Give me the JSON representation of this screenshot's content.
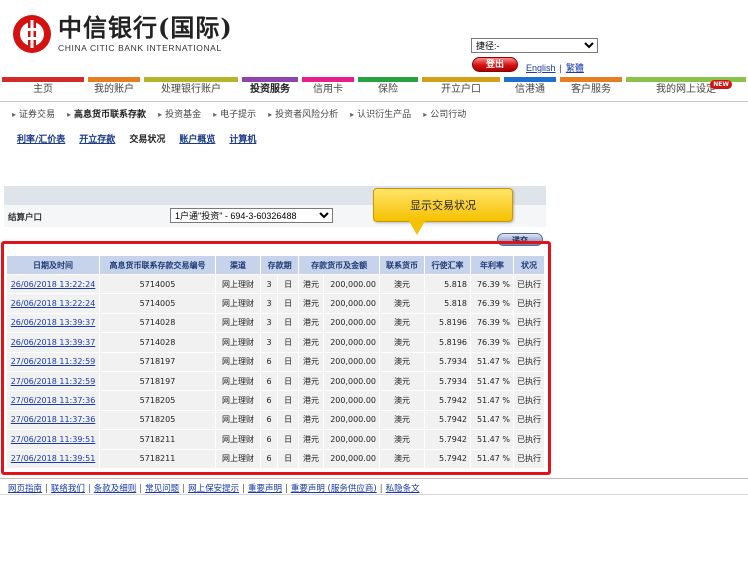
{
  "brand": {
    "name_cn": "中信银行(国际)",
    "name_en": "CHINA CITIC BANK INTERNATIONAL"
  },
  "header": {
    "quick_select_value": "捷径:-",
    "logout_label": "登出",
    "lang_english": "English",
    "lang_sep": "|",
    "lang_traditional": "繁體"
  },
  "nav": [
    {
      "label": "主页",
      "color": "#d12a2a"
    },
    {
      "label": "我的账户",
      "color": "#e67e22"
    },
    {
      "label": "处理银行账户",
      "color": "#b5b52b"
    },
    {
      "label": "投资服务",
      "color": "#8e44ad"
    },
    {
      "label": "信用卡",
      "color": "#e91e8c"
    },
    {
      "label": "保险",
      "color": "#27a243"
    },
    {
      "label": "开立户口",
      "color": "#d4a017"
    },
    {
      "label": "信港通",
      "color": "#1f6fd1"
    },
    {
      "label": "客户服务",
      "color": "#e67e22"
    },
    {
      "label": "我的网上设定",
      "color": "#8bc34a",
      "badge": "NEW"
    }
  ],
  "subnav": [
    {
      "label": "证券交易"
    },
    {
      "label": "高息货币联系存款"
    },
    {
      "label": "投资基金"
    },
    {
      "label": "电子提示"
    },
    {
      "label": "投资者风险分析"
    },
    {
      "label": "认识衍生产品"
    },
    {
      "label": "公司行动"
    }
  ],
  "tabs": [
    {
      "label": "利率/汇价表"
    },
    {
      "label": "开立存款"
    },
    {
      "label": "交易状况"
    },
    {
      "label": "账户概览"
    },
    {
      "label": "计算机"
    }
  ],
  "settlement": {
    "label": "结算户口",
    "account_value": "1户通\"投资\" - 694-3-60326488"
  },
  "callout": {
    "text": "显示交易状况"
  },
  "submit_label": "递交",
  "table": {
    "headers": [
      "日期及时间",
      "高息货币联系存款交易编号",
      "渠道",
      "存款期",
      "存款货币及金额",
      "联系货币",
      "行使汇率",
      "年利率",
      "状况"
    ],
    "rows": [
      {
        "datetime": "26/06/2018 13:22:24",
        "ref": "5714005",
        "channel": "网上理财",
        "term_num": "3",
        "term_unit": "日",
        "currency": "港元",
        "amount": "200,000.00",
        "linked": "澳元",
        "rate": "5.818",
        "interest": "76.39 %",
        "status": "已执行"
      },
      {
        "datetime": "26/06/2018 13:22:24",
        "ref": "5714005",
        "channel": "网上理财",
        "term_num": "3",
        "term_unit": "日",
        "currency": "港元",
        "amount": "200,000.00",
        "linked": "澳元",
        "rate": "5.818",
        "interest": "76.39 %",
        "status": "已执行"
      },
      {
        "datetime": "26/06/2018 13:39:37",
        "ref": "5714028",
        "channel": "网上理财",
        "term_num": "3",
        "term_unit": "日",
        "currency": "港元",
        "amount": "200,000.00",
        "linked": "澳元",
        "rate": "5.8196",
        "interest": "76.39 %",
        "status": "已执行"
      },
      {
        "datetime": "26/06/2018 13:39:37",
        "ref": "5714028",
        "channel": "网上理财",
        "term_num": "3",
        "term_unit": "日",
        "currency": "港元",
        "amount": "200,000.00",
        "linked": "澳元",
        "rate": "5.8196",
        "interest": "76.39 %",
        "status": "已执行"
      },
      {
        "datetime": "27/06/2018 11:32:59",
        "ref": "5718197",
        "channel": "网上理财",
        "term_num": "6",
        "term_unit": "日",
        "currency": "港元",
        "amount": "200,000.00",
        "linked": "澳元",
        "rate": "5.7934",
        "interest": "51.47 %",
        "status": "已执行"
      },
      {
        "datetime": "27/06/2018 11:32:59",
        "ref": "5718197",
        "channel": "网上理财",
        "term_num": "6",
        "term_unit": "日",
        "currency": "港元",
        "amount": "200,000.00",
        "linked": "澳元",
        "rate": "5.7934",
        "interest": "51.47 %",
        "status": "已执行"
      },
      {
        "datetime": "27/06/2018 11:37:36",
        "ref": "5718205",
        "channel": "网上理财",
        "term_num": "6",
        "term_unit": "日",
        "currency": "港元",
        "amount": "200,000.00",
        "linked": "澳元",
        "rate": "5.7942",
        "interest": "51.47 %",
        "status": "已执行"
      },
      {
        "datetime": "27/06/2018 11:37:36",
        "ref": "5718205",
        "channel": "网上理财",
        "term_num": "6",
        "term_unit": "日",
        "currency": "港元",
        "amount": "200,000.00",
        "linked": "澳元",
        "rate": "5.7942",
        "interest": "51.47 %",
        "status": "已执行"
      },
      {
        "datetime": "27/06/2018 11:39:51",
        "ref": "5718211",
        "channel": "网上理财",
        "term_num": "6",
        "term_unit": "日",
        "currency": "港元",
        "amount": "200,000.00",
        "linked": "澳元",
        "rate": "5.7942",
        "interest": "51.47 %",
        "status": "已执行"
      },
      {
        "datetime": "27/06/2018 11:39:51",
        "ref": "5718211",
        "channel": "网上理财",
        "term_num": "6",
        "term_unit": "日",
        "currency": "港元",
        "amount": "200,000.00",
        "linked": "澳元",
        "rate": "5.7942",
        "interest": "51.47 %",
        "status": "已执行"
      }
    ]
  },
  "footer": [
    {
      "label": "网页指南"
    },
    {
      "label": "联络我们"
    },
    {
      "label": "条款及细则"
    },
    {
      "label": "常见问题"
    },
    {
      "label": "网上保安提示"
    },
    {
      "label": "重要声明"
    },
    {
      "label": "重要声明 (服务供应商)"
    },
    {
      "label": "私隐条文"
    }
  ],
  "colors": {
    "brand_red": "#d31212",
    "highlight_red": "#e0131b",
    "header_blue": "#c6d3ea",
    "callout_yellow": "#f6c100"
  }
}
